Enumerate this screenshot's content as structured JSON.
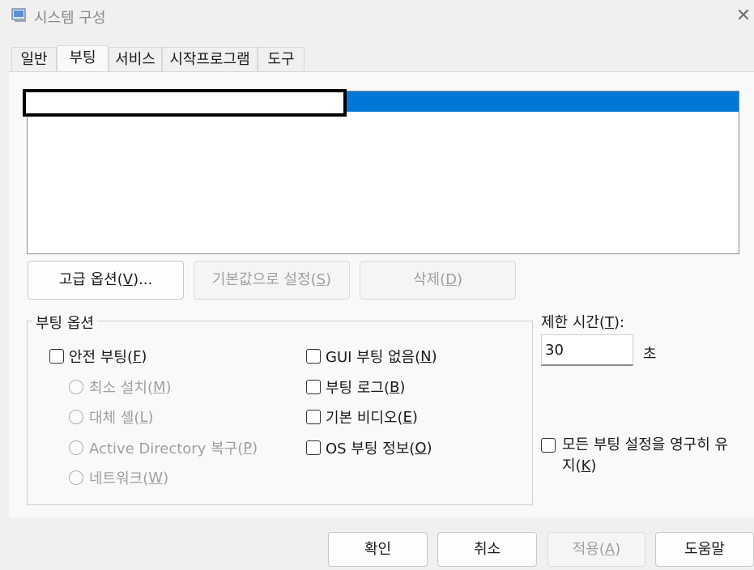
{
  "window": {
    "title": "시스템 구성"
  },
  "tabs": [
    {
      "label": "일반"
    },
    {
      "label": "부팅"
    },
    {
      "label": "서비스"
    },
    {
      "label": "시작프로그램"
    },
    {
      "label": "도구"
    }
  ],
  "boot_buttons": {
    "advanced_pre": "고급 옵션(",
    "advanced_key": "V",
    "advanced_post": ")...",
    "default_pre": "기본값으로 설정(",
    "default_key": "S",
    "default_post": ")",
    "delete_pre": "삭제(",
    "delete_key": "D",
    "delete_post": ")"
  },
  "boot_options": {
    "title": "부팅 옵션",
    "safe_boot_pre": "안전 부팅(",
    "safe_boot_key": "F",
    "safe_boot_post": ")",
    "minimal_pre": "최소 설치(",
    "minimal_key": "M",
    "minimal_post": ")",
    "alt_shell_pre": "대체 셸(",
    "alt_shell_key": "L",
    "alt_shell_post": ")",
    "ad_repair_pre": "Active Directory 복구(",
    "ad_repair_key": "P",
    "ad_repair_post": ")",
    "network_pre": "네트워크(",
    "network_key": "W",
    "network_post": ")",
    "no_gui_pre": "GUI 부팅 없음(",
    "no_gui_key": "N",
    "no_gui_post": ")",
    "boot_log_pre": "부팅 로그(",
    "boot_log_key": "B",
    "boot_log_post": ")",
    "base_video_pre": "기본 비디오(",
    "base_video_key": "E",
    "base_video_post": ")",
    "os_info_pre": "OS 부팅 정보(",
    "os_info_key": "O",
    "os_info_post": ")"
  },
  "timeout": {
    "label_pre": "제한 시간(",
    "label_key": "T",
    "label_post": "):",
    "value": "30",
    "unit": "초"
  },
  "persist": {
    "line1": "모든 부팅 설정을 영구히 유",
    "line2_pre": "지(",
    "line2_key": "K",
    "line2_post": ")"
  },
  "dialog_buttons": {
    "ok": "확인",
    "cancel": "취소",
    "apply_pre": "적용(",
    "apply_key": "A",
    "apply_post": ")",
    "help": "도움말"
  },
  "colors": {
    "selection": "#0078d7"
  }
}
